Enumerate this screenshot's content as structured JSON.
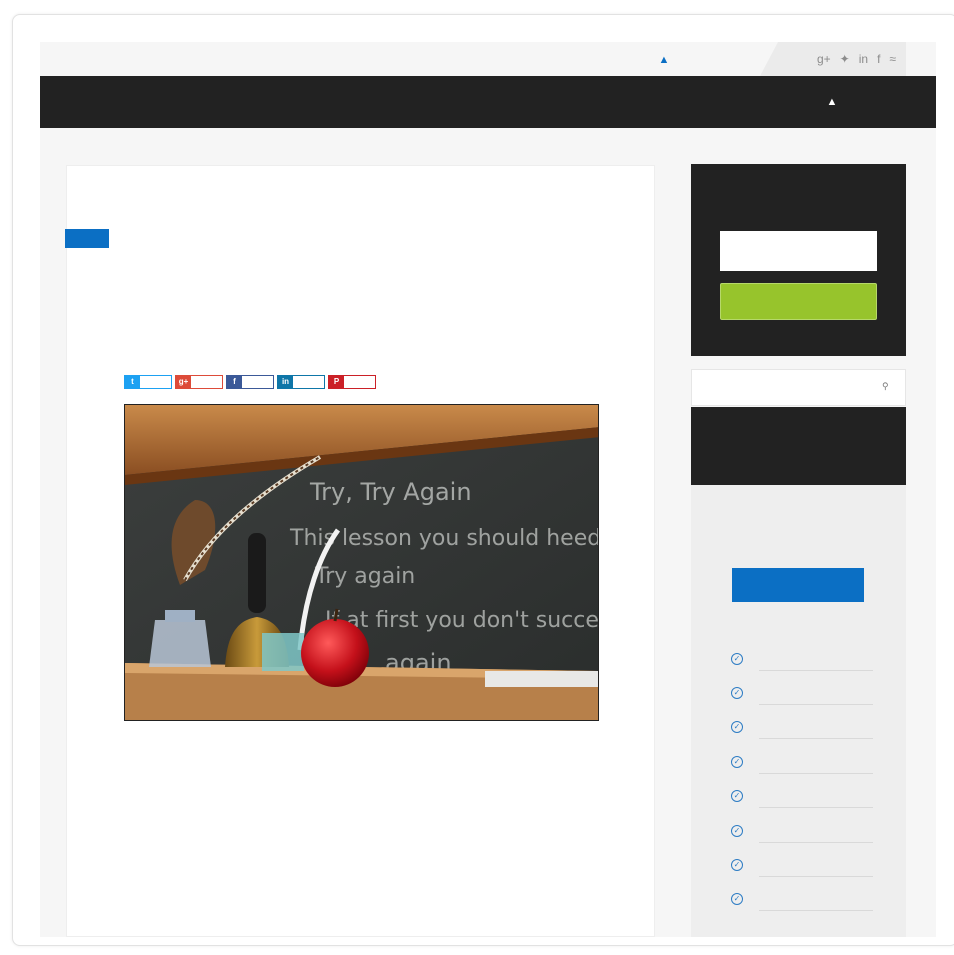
{
  "header": {
    "user_icon": "user-icon",
    "social_icons": [
      "google-plus-icon",
      "twitter-icon",
      "linkedin-icon",
      "facebook-icon",
      "rss-icon"
    ],
    "social_glyphs": [
      "g+",
      "✦",
      "in",
      "f",
      "≈"
    ]
  },
  "navbar": {
    "user_icon": "user-icon",
    "background": "#222222"
  },
  "article": {
    "category_color": "#0b6fc4",
    "share_buttons": [
      {
        "name": "twitter",
        "icon": "twitter-icon",
        "glyph": "t",
        "color": "#1da1f2"
      },
      {
        "name": "google-plus",
        "icon": "google-plus-icon",
        "glyph": "g+",
        "color": "#dd4b39"
      },
      {
        "name": "facebook",
        "icon": "facebook-icon",
        "glyph": "f",
        "color": "#3b5998"
      },
      {
        "name": "linkedin",
        "icon": "linkedin-icon",
        "glyph": "in",
        "color": "#0e76a8"
      },
      {
        "name": "pinterest",
        "icon": "pinterest-icon",
        "glyph": "P",
        "color": "#cb2027"
      }
    ],
    "hero_image": {
      "chalkboard_lines": [
        "Try, Try Again",
        "This lesson you should heed",
        "Try again",
        "If at first you don't succeed",
        "again"
      ]
    }
  },
  "sidebar": {
    "subscribe_button_color": "#97c42c",
    "search_icon": "search-icon",
    "cta_button_color": "#0b6fc4",
    "list_icon": "check-circle-icon",
    "list_count": 8
  }
}
